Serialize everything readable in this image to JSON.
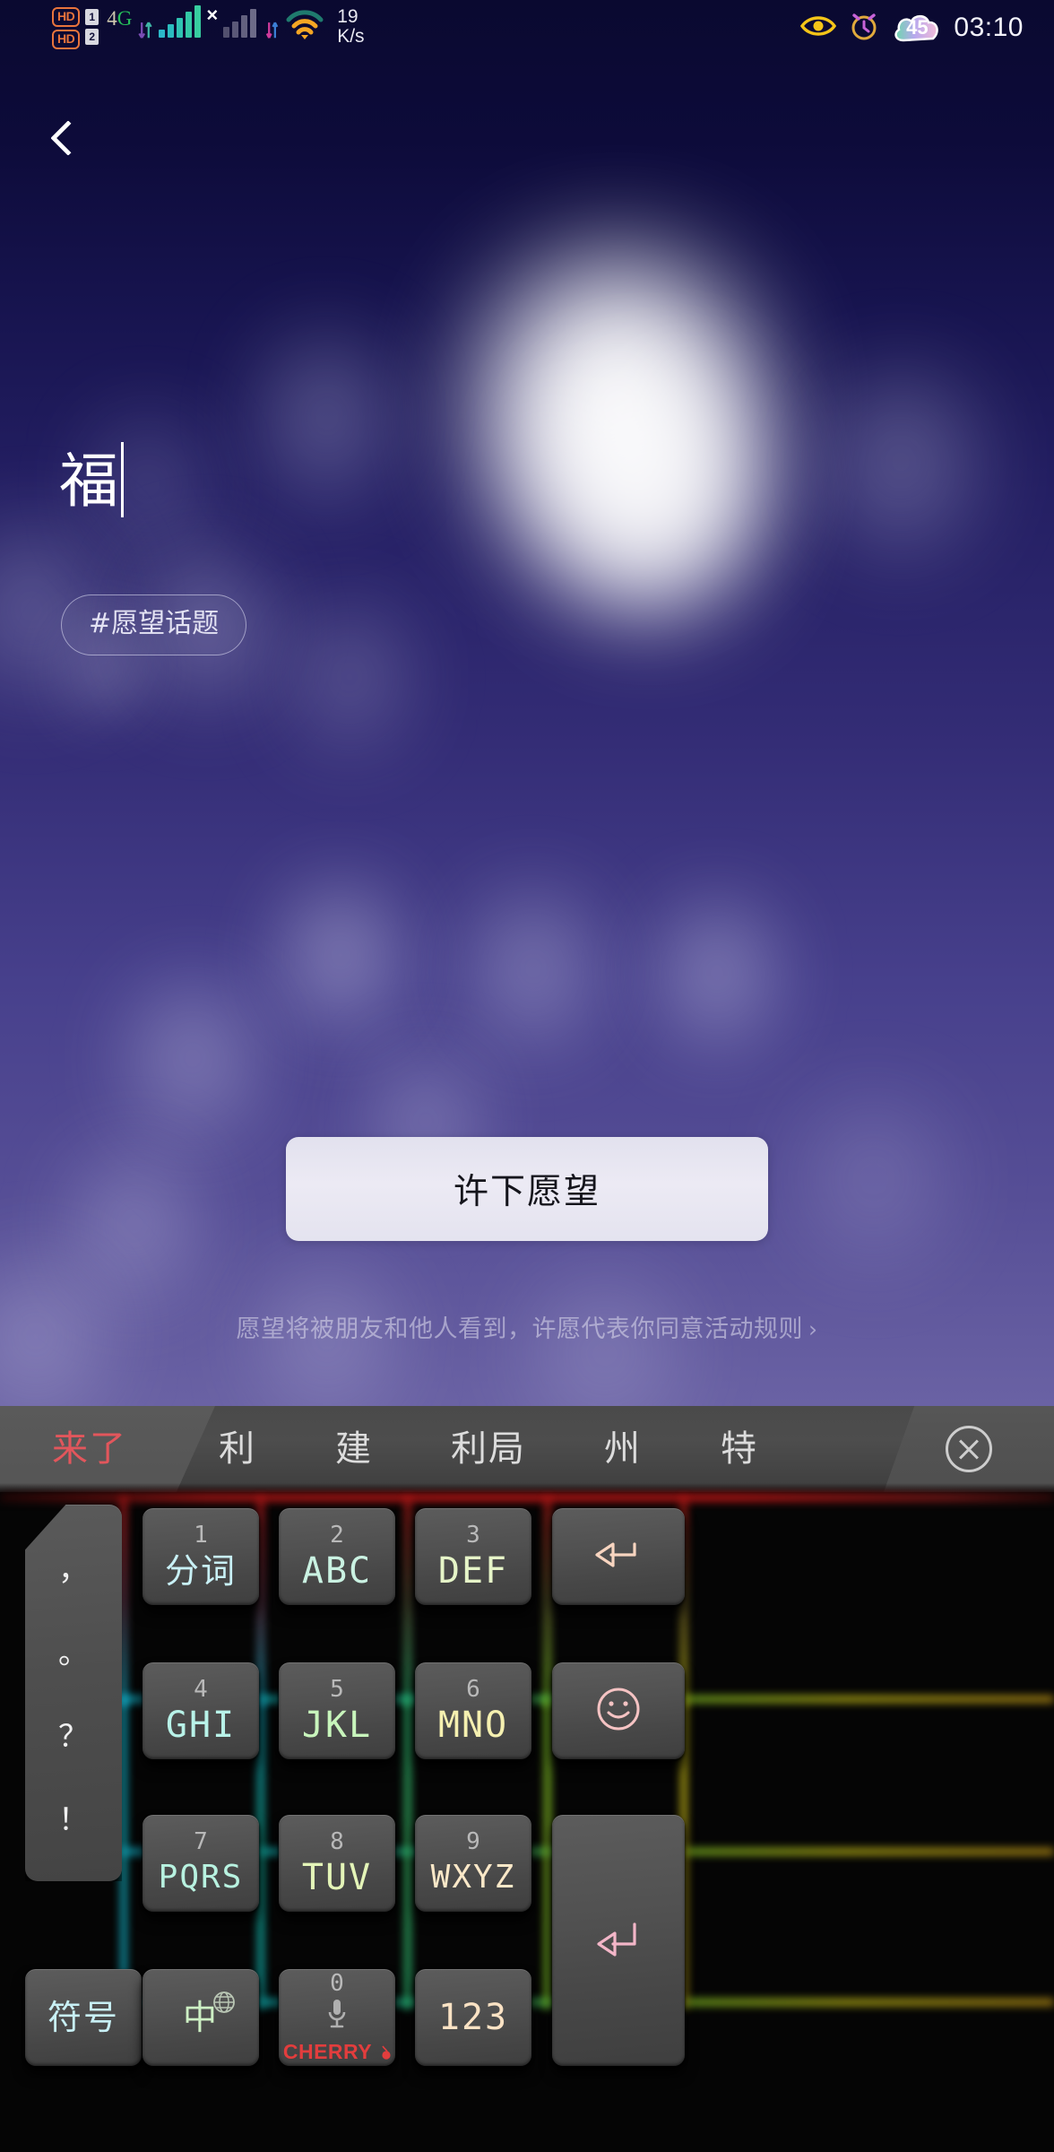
{
  "status_bar": {
    "hd_badges": [
      "HD",
      "HD"
    ],
    "sim_labels": [
      "1",
      "2"
    ],
    "network": "4G",
    "network_g": "G",
    "x_mark": "×",
    "speed_value": "19",
    "speed_unit": "K/s",
    "battery": "45",
    "time": "03:10",
    "icons": [
      "eye-icon",
      "alarm-clock-icon",
      "cloud-battery-icon"
    ]
  },
  "nav": {
    "back_icon": "chevron-left-icon"
  },
  "editor": {
    "text": "福",
    "topic_chip": "#愿望话题"
  },
  "cta": {
    "label": "许下愿望",
    "notice": "愿望将被朋友和他人看到，许愿代表你同意活动规则",
    "notice_arrow": "›"
  },
  "keyboard": {
    "candidates": [
      {
        "text": "来了",
        "selected": true
      },
      {
        "text": "利",
        "selected": false
      },
      {
        "text": "建",
        "selected": false
      },
      {
        "text": "利局",
        "selected": false
      },
      {
        "text": "州",
        "selected": false
      },
      {
        "text": "特",
        "selected": false
      }
    ],
    "close_icon": "circle-x-icon",
    "punctuation": [
      "，",
      "。",
      "？",
      "！"
    ],
    "keys": {
      "k1_num": "1",
      "k1_label": "分词",
      "k2_num": "2",
      "k2_label": "ABC",
      "k3_num": "3",
      "k3_label": "DEF",
      "k4_num": "4",
      "k4_label": "GHI",
      "k5_num": "5",
      "k5_label": "JKL",
      "k6_num": "6",
      "k6_label": "MNO",
      "k7_num": "7",
      "k7_label": "PQRS",
      "k8_num": "8",
      "k8_label": "TUV",
      "k9_num": "9",
      "k9_label": "WXYZ",
      "k0_num": "0",
      "symbols_label": "符号",
      "lang_label": "中",
      "numeric_label": "123",
      "brand_label": "CHERRY",
      "backspace_icon": "backspace-icon",
      "emoji_icon": "smiley-icon",
      "enter_icon": "enter-return-icon",
      "mic_icon": "microphone-icon",
      "globe_icon": "globe-icon"
    }
  },
  "colors": {
    "bg_top": "#0a0930",
    "bg_bottom": "#6a62a4",
    "accent_red": "#e2565c",
    "key_face": "#515151",
    "cta_bg": "#eceaf4",
    "hd_orange": "#e8743c",
    "net_green": "#25c05a",
    "cherry_red": "#e23d3d"
  }
}
